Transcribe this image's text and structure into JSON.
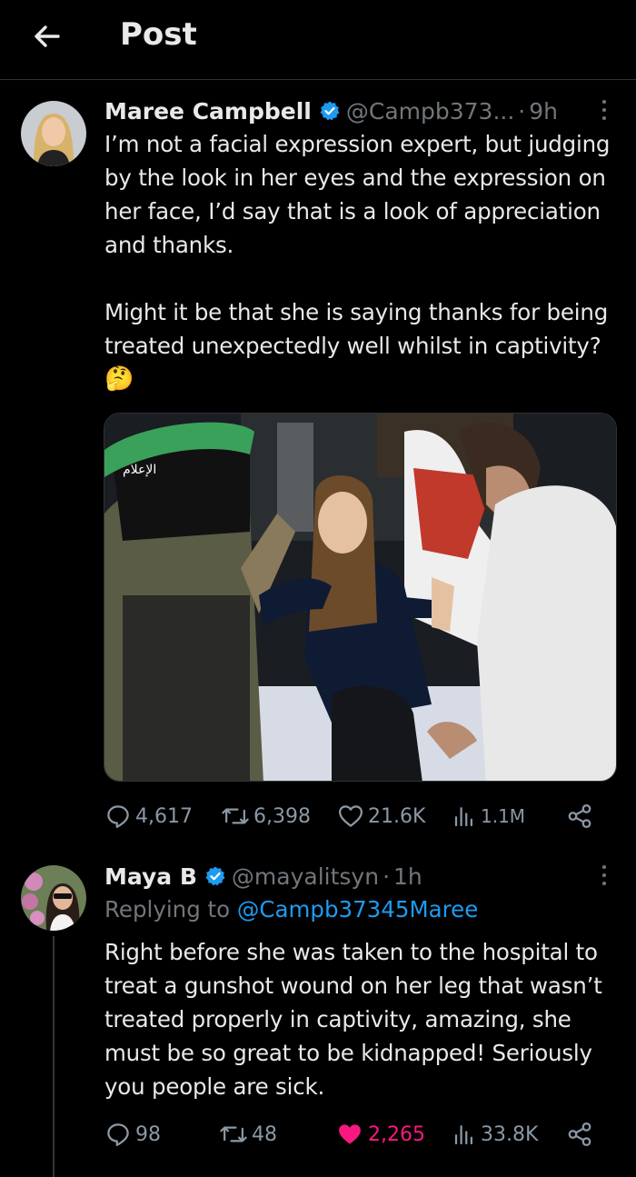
{
  "header": {
    "title": "Post"
  },
  "post": {
    "author_name": "Maree Campbell",
    "handle": "@Campb373...",
    "separator": "·",
    "time": "9h",
    "paragraphs": [
      "I’m not a facial expression expert, but judging by the look in her eyes and the expression on her face, I’d say that is a look of appreciation and thanks.",
      "Might it be that she is saying thanks for being treated unexpectedly well whilst in captivity?"
    ],
    "emoji": "🤔",
    "media_watermark": "الإعلام",
    "stats": {
      "replies": "4,617",
      "reposts": "6,398",
      "likes": "21.6K",
      "views": "1.1M"
    }
  },
  "reply": {
    "author_name": "Maya B",
    "handle": "@mayalitsyn",
    "separator": "·",
    "time": "1h",
    "replying_prefix": "Replying to",
    "replying_to": "@Campb37345Maree",
    "text": "Right before she was taken to the hospital to treat a gunshot wound on her leg that wasn’t treated properly in captivity, amazing, she must be so great to be kidnapped! Seriously you people are sick.",
    "stats": {
      "replies": "98",
      "reposts": "48",
      "likes": "2,265",
      "views": "33.8K"
    }
  },
  "colors": {
    "background": "#000000",
    "text": "#e7e9ea",
    "secondary": "#71767b",
    "accent": "#1d9bf0",
    "like_active": "#f91880"
  },
  "icons": [
    "back-arrow-icon",
    "verified-badge-icon",
    "more-icon",
    "reply-icon",
    "repost-icon",
    "like-icon",
    "views-icon",
    "share-icon"
  ]
}
